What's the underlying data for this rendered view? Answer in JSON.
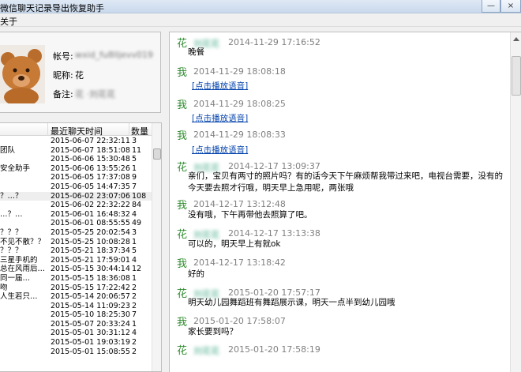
{
  "window": {
    "title": "微信聊天记录导出恢复助手",
    "min": "—",
    "close": "×"
  },
  "menu": {
    "about": "关于"
  },
  "profile": {
    "account_label": "帐号:",
    "account_value": "wxid_fu8lljevv019",
    "nickname_label": "昵称:",
    "nickname_value": "花",
    "remark_label": "备注:",
    "remark_value": "花 ·刘花花"
  },
  "list": {
    "headers": [
      "",
      "最近聊天时间",
      "数量"
    ],
    "rows": [
      {
        "name": "",
        "time": "2015-06-07 22:32:11",
        "count": "3"
      },
      {
        "name": "团队",
        "time": "2015-06-07 18:51:08",
        "count": "11"
      },
      {
        "name": "",
        "time": "2015-06-06 15:30:48",
        "count": "5"
      },
      {
        "name": "安全助手",
        "time": "2015-06-06 13:55:26",
        "count": "1"
      },
      {
        "name": "",
        "time": "2015-06-05 17:37:08",
        "count": "9"
      },
      {
        "name": "",
        "time": "2015-06-05 14:47:35",
        "count": "7"
      },
      {
        "name": "  ？…？",
        "time": "2015-06-02 23:07:06",
        "count": "108"
      },
      {
        "name": "",
        "time": "2015-06-02 22:32:22",
        "count": "84"
      },
      {
        "name": "…？…",
        "time": "2015-06-01 16:48:32",
        "count": "4"
      },
      {
        "name": "",
        "time": "2015-06-01 08:55:55",
        "count": "49"
      },
      {
        "name": "？？？",
        "time": "2015-05-25 20:02:54",
        "count": "3"
      },
      {
        "name": "不见不散？？",
        "time": "2015-05-25 10:08:28",
        "count": "1"
      },
      {
        "name": "？？？",
        "time": "2015-05-21 18:37:34",
        "count": "5"
      },
      {
        "name": "三星手机的",
        "time": "2015-05-21 17:59:01",
        "count": "4"
      },
      {
        "name": "总在风雨后…",
        "time": "2015-05-15 30:44:14",
        "count": "12"
      },
      {
        "name": "同一届…",
        "time": "2015-05-15 18:36:08",
        "count": "1"
      },
      {
        "name": "吻",
        "time": "2015-05-15 17:22:42",
        "count": "2"
      },
      {
        "name": " 人生若只…",
        "time": "2015-05-14 20:06:57",
        "count": "2"
      },
      {
        "name": "",
        "time": "2015-05-14 11:09:23",
        "count": "2"
      },
      {
        "name": "",
        "time": "2015-05-10 18:25:30",
        "count": "7"
      },
      {
        "name": "",
        "time": "2015-05-07 20:33:24",
        "count": "1"
      },
      {
        "name": "",
        "time": "2015-05-01 30:31:12",
        "count": "4"
      },
      {
        "name": "",
        "time": "2015-05-01 19:03:19",
        "count": "2"
      },
      {
        "name": "",
        "time": "2015-05-01 15:08:55",
        "count": "2"
      }
    ]
  },
  "chat": {
    "link_label": "[点击播放语音]",
    "messages": [
      {
        "who": "花",
        "name": "刘花花",
        "ts": "2014-11-29 17:16:52",
        "text": "晚餐"
      },
      {
        "who": "我",
        "name": "",
        "ts": "2014-11-29 18:08:18",
        "text": ""
      },
      {
        "who": "我",
        "name": "",
        "ts": "2014-11-29 18:08:25",
        "text": ""
      },
      {
        "who": "我",
        "name": "",
        "ts": "2014-11-29 18:08:33",
        "text": ""
      },
      {
        "who": "花",
        "name": "刘花花",
        "ts": "2014-12-17 13:09:37",
        "text": "亲们，宝贝有两寸的照片吗？有的话今天下午麻烦帮我带过来吧，电视台需要，没有的今天要去照才行哦，明天早上急用呢，两张哦"
      },
      {
        "who": "我",
        "name": "",
        "ts": "2014-12-17 13:12:48",
        "text": "没有哦，下午再带他去照算了吧。"
      },
      {
        "who": "花",
        "name": "刘花花",
        "ts": "2014-12-17 13:13:38",
        "text": "可以的，明天早上有就ok"
      },
      {
        "who": "我",
        "name": "",
        "ts": "2014-12-17 13:18:42",
        "text": "好的"
      },
      {
        "who": "花",
        "name": "刘花花",
        "ts": "2015-01-20 17:57:17",
        "text": "明天幼儿园舞蹈班有舞蹈展示课，明天一点半到幼儿园哦"
      },
      {
        "who": "我",
        "name": "",
        "ts": "2015-01-20 17:58:07",
        "text": "家长要到吗？"
      },
      {
        "who": "花",
        "name": "刘花花",
        "ts": "2015-01-20 17:58:19",
        "text": ""
      }
    ]
  }
}
